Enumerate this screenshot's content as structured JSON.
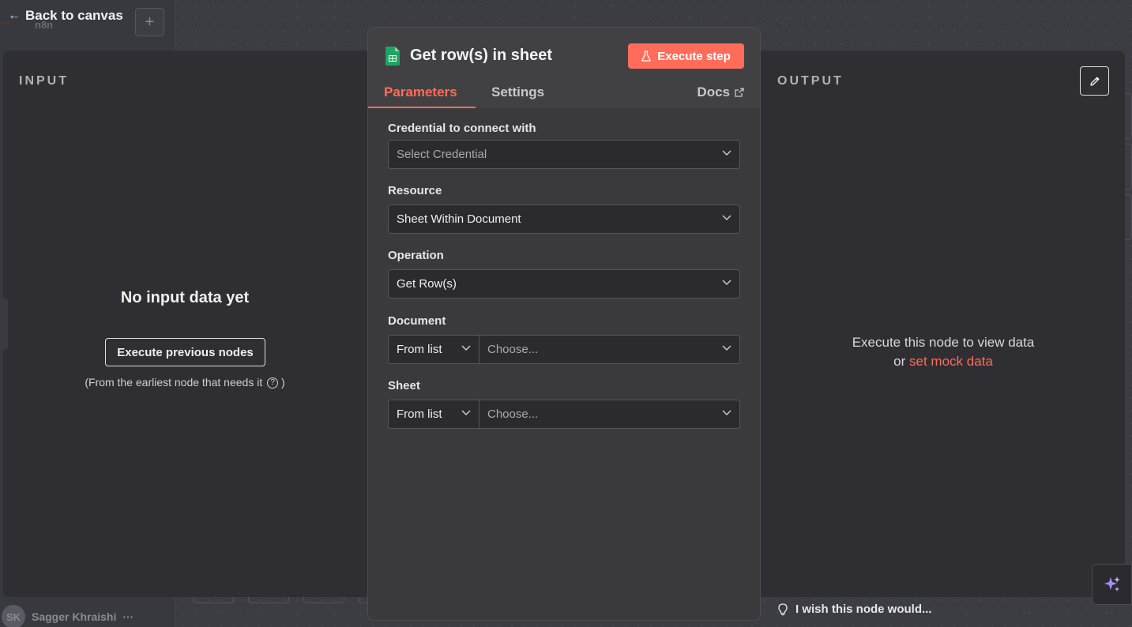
{
  "background": {
    "logo_text": "n8n",
    "user": {
      "initials": "SK",
      "name": "Sagger Khraishi"
    }
  },
  "header": {
    "back_label": "Back to canvas",
    "add_label": "+"
  },
  "input_panel": {
    "title": "INPUT",
    "empty_message": "No input data yet",
    "execute_button": "Execute previous nodes",
    "note_prefix": "(From the earliest node that needs it",
    "note_suffix": ")"
  },
  "output_panel": {
    "title": "OUTPUT",
    "message_line1": "Execute this node to view data",
    "message_or": "or",
    "mock_link": "set mock data"
  },
  "node": {
    "title": "Get row(s) in sheet",
    "execute_step": "Execute step",
    "tabs": {
      "parameters": "Parameters",
      "settings": "Settings",
      "docs": "Docs"
    },
    "fields": {
      "credential": {
        "label": "Credential to connect with",
        "placeholder": "Select Credential"
      },
      "resource": {
        "label": "Resource",
        "value": "Sheet Within Document"
      },
      "operation": {
        "label": "Operation",
        "value": "Get Row(s)"
      },
      "document": {
        "label": "Document",
        "mode": "From list",
        "placeholder": "Choose..."
      },
      "sheet": {
        "label": "Sheet",
        "mode": "From list",
        "placeholder": "Choose..."
      }
    }
  },
  "footer": {
    "wish_text": "I wish this node would..."
  },
  "colors": {
    "accent": "#ff6d5a",
    "sheets_green": "#1fa463"
  }
}
